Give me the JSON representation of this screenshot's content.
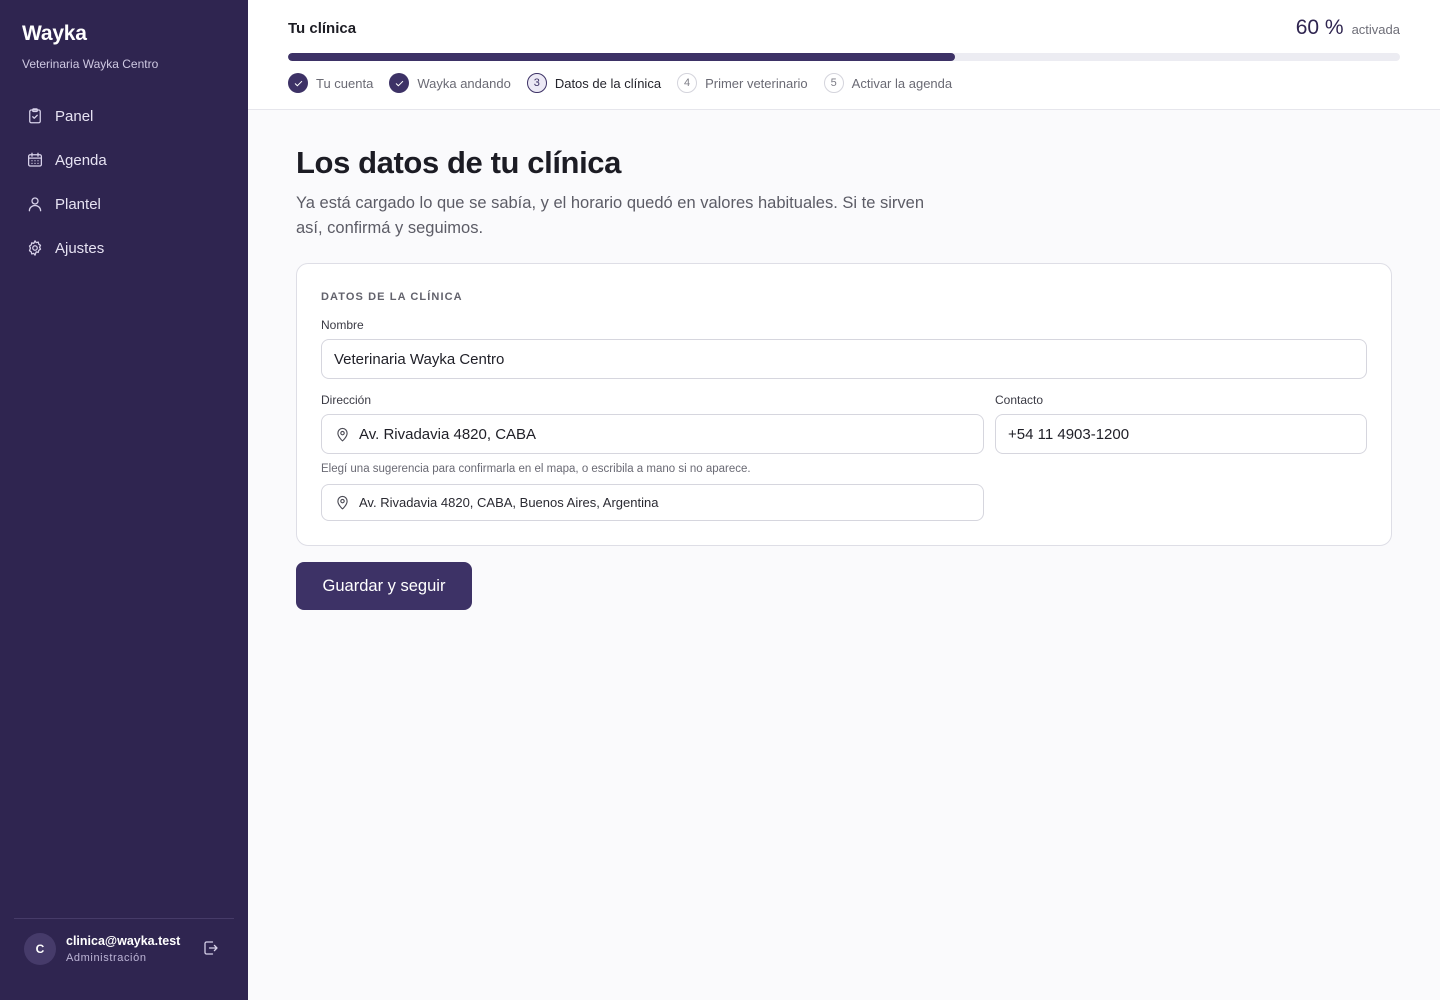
{
  "sidebar": {
    "brand": "Wayka",
    "clinic_name": "Veterinaria Wayka Centro",
    "items": [
      {
        "label": "Panel",
        "icon": "clipboard-icon"
      },
      {
        "label": "Agenda",
        "icon": "calendar-icon"
      },
      {
        "label": "Plantel",
        "icon": "user-icon"
      },
      {
        "label": "Ajustes",
        "icon": "gear-icon"
      }
    ],
    "user": {
      "initial": "C",
      "email": "clinica@wayka.test",
      "role": "Administración",
      "logout_icon": "logout-icon"
    }
  },
  "header": {
    "title": "Tu clínica",
    "percent": "60 %",
    "percent_label": "activada",
    "progress": 0.6,
    "steps": [
      {
        "label": "Tu cuenta",
        "state": "done",
        "number": "1"
      },
      {
        "label": "Wayka andando",
        "state": "done",
        "number": "2"
      },
      {
        "label": "Datos de la clínica",
        "state": "current",
        "number": "3"
      },
      {
        "label": "Primer veterinario",
        "state": "todo",
        "number": "4"
      },
      {
        "label": "Activar la agenda",
        "state": "todo",
        "number": "5"
      }
    ]
  },
  "main": {
    "title": "Los datos de tu clínica",
    "intro": "Ya está cargado lo que se sabía, y el horario quedó en valores habituales. Si te sirven así, confirmá y seguimos.",
    "card": {
      "title": "DATOS DE LA CLÍNICA",
      "name_label": "Nombre",
      "name_value": "Veterinaria Wayka Centro",
      "address_label": "Dirección",
      "address_value": "Av. Rivadavia 4820, CABA",
      "contact_label": "Contacto",
      "contact_value": "+54 11 4903-1200",
      "hint": "Elegí una sugerencia para confirmarla en el mapa, o escribila a mano si no aparece.",
      "suggestion": "Av. Rivadavia 4820, CABA, Buenos Aires, Argentina"
    },
    "submit_label": "Guardar y seguir"
  },
  "colors": {
    "sidebar_bg": "#2f2550",
    "accent": "#3d3266",
    "progress_track": "#ececf2"
  }
}
